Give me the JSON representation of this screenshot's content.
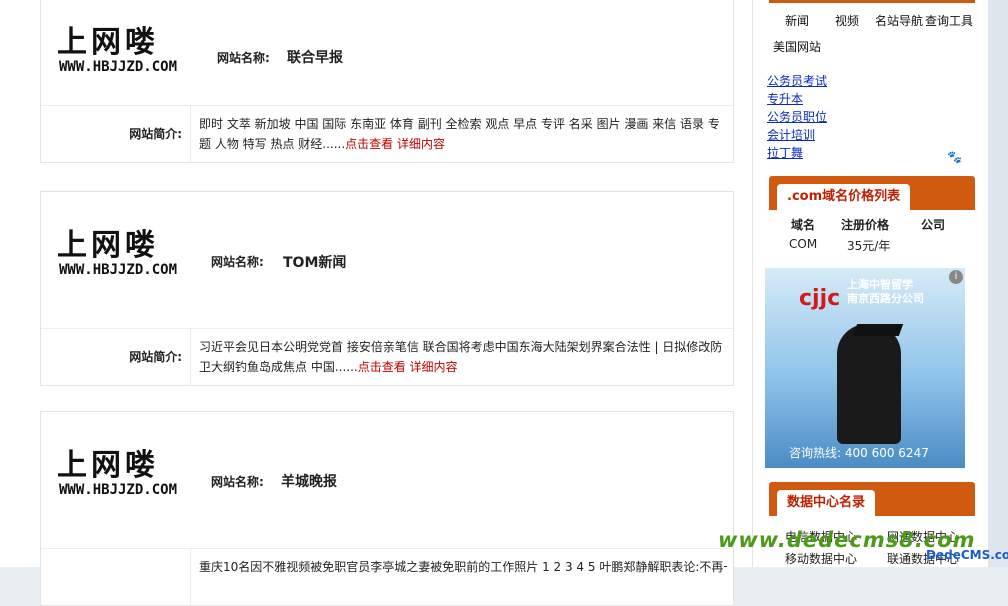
{
  "cards": [
    {
      "logo_cn": "上网喽",
      "logo_en": "WWW.HBJJZD.COM",
      "name_label": "网站名称:",
      "name_value": "联合早报",
      "intro_label": "网站简介:",
      "intro_text": "即时 文萃 新加坡 中国 国际 东南亚 体育 副刊 全检索 观点 早点 专评 名采 图片 漫画 来信 语录 专题 人物 特写 热点 财经......",
      "link_view": "点击查看",
      "link_detail": "详细内容"
    },
    {
      "logo_cn": "上网喽",
      "logo_en": "WWW.HBJJZD.COM",
      "name_label": "网站名称:",
      "name_value": "TOM新闻",
      "intro_label": "网站简介:",
      "intro_text": "习近平会见日本公明党党首 接安倍亲笔信 联合国将考虑中国东海大陆架划界案合法性 | 日拟修改防卫大纲钓鱼岛成焦点 中国......",
      "link_view": "点击查看",
      "link_detail": "详细内容"
    },
    {
      "logo_cn": "上网喽",
      "logo_en": "WWW.HBJJZD.COM",
      "name_label": "网站名称:",
      "name_value": "羊城晚报",
      "intro_label": "",
      "intro_text": "重庆10名因不雅视频被免职官员李亭城之妻被免职前的工作照片 1 2 3 4 5 叶鹏郑静解职表论:不再一",
      "link_view": "",
      "link_detail": ""
    }
  ],
  "sidebar": {
    "nav_row1": [
      "新闻",
      "视频",
      "名站导航",
      "查询工具"
    ],
    "nav_row2": [
      "美国网站"
    ],
    "links": [
      "公务员考试",
      "专升本",
      "公务员职位",
      "会计培训",
      "拉丁舞"
    ],
    "domain_panel": {
      "title": ".com域名价格列表",
      "headers": [
        "域名",
        "注册价格",
        "公司"
      ],
      "row": [
        "COM",
        "35元/年",
        ""
      ]
    },
    "ad": {
      "brand": "cjjc",
      "header_line1": "上海中智留学",
      "header_line2": "南京西路分公司",
      "hotline": "咨询热线: 400 600 6247",
      "info_icon": "i"
    },
    "data_center": {
      "title": "数据中心名录",
      "items": [
        "电信数据中心",
        "网通数据中心",
        "移动数据中心",
        "联通数据中心"
      ]
    }
  },
  "watermark": {
    "text": "www.dedecms8.com",
    "text2": "DedeCMS.com"
  }
}
